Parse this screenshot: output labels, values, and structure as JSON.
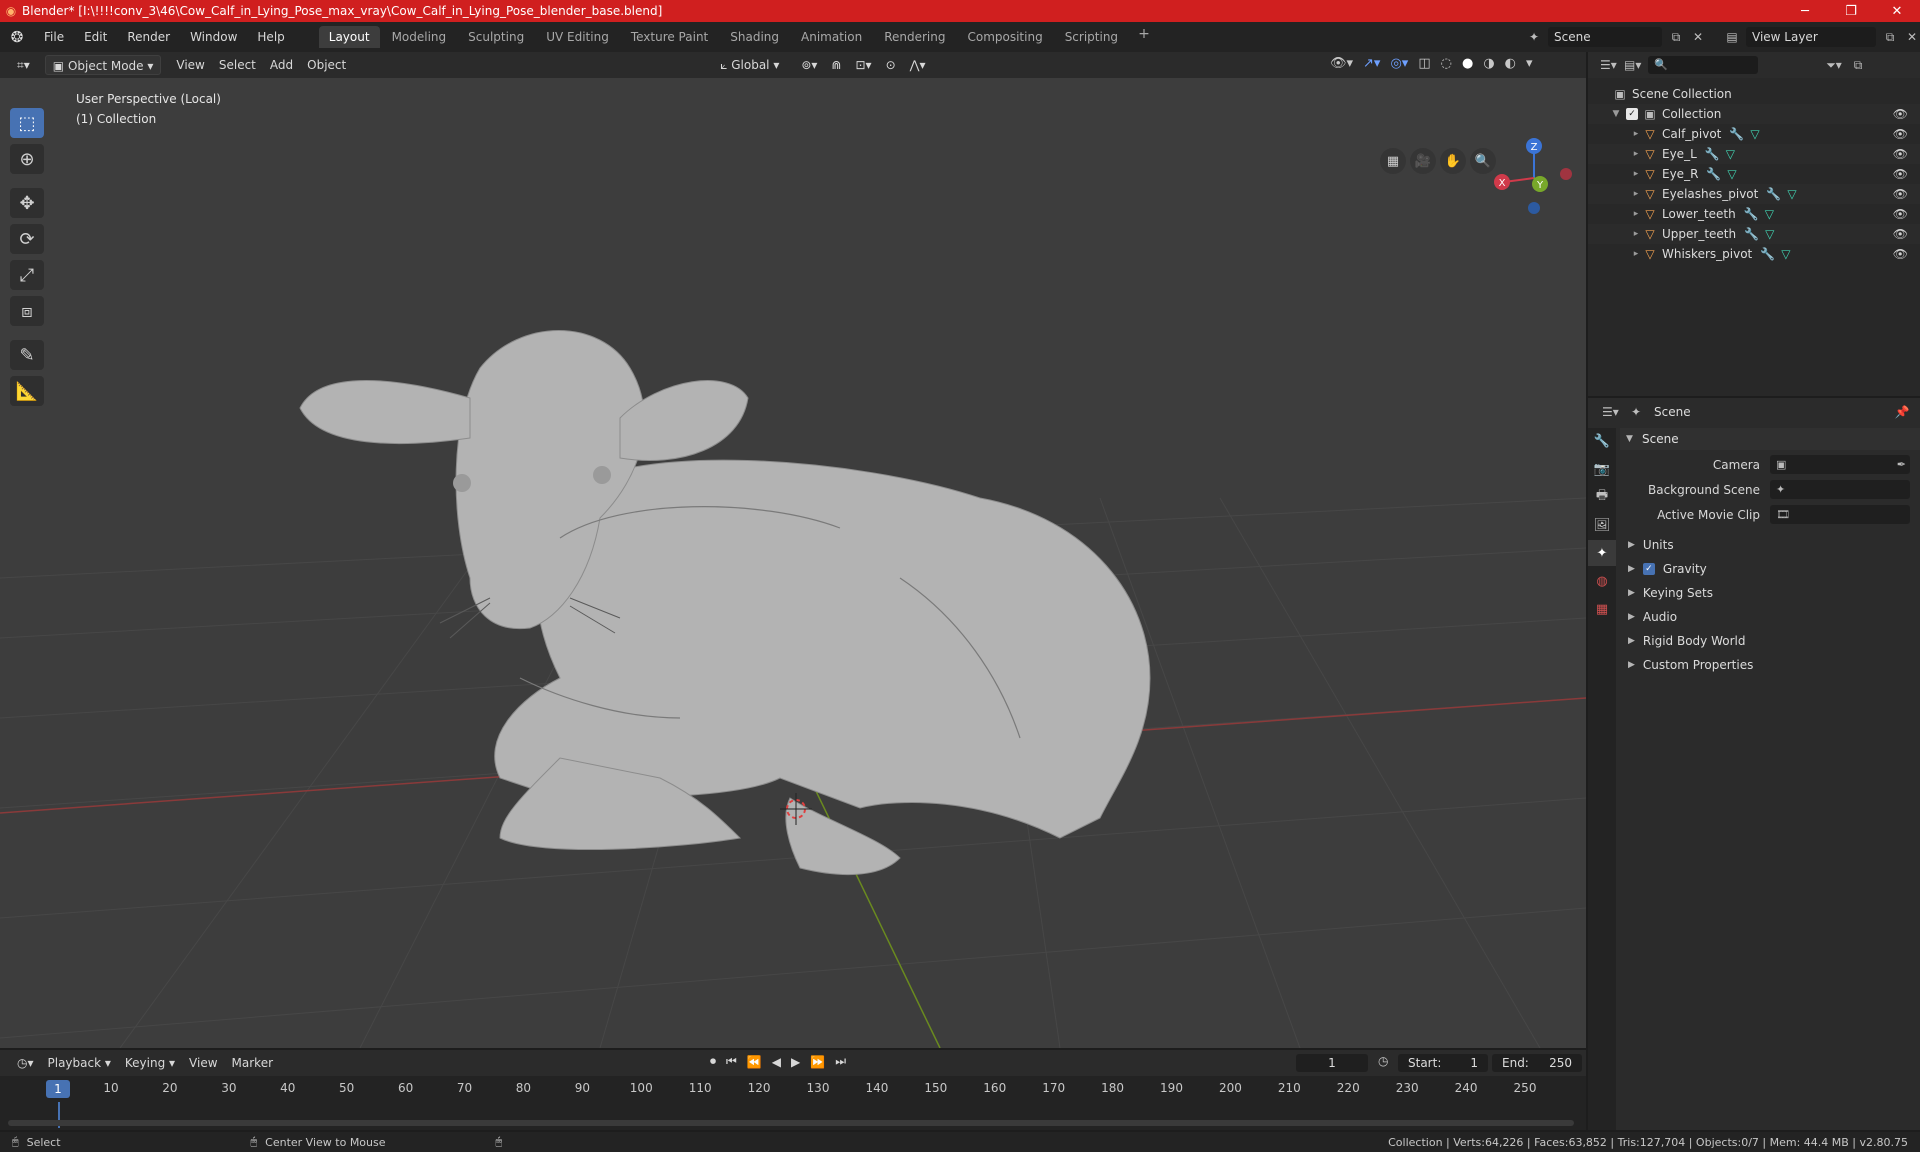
{
  "window": {
    "title": "Blender* [I:\\!!!!conv_3\\46\\Cow_Calf_in_Lying_Pose_max_vray\\Cow_Calf_in_Lying_Pose_blender_base.blend]",
    "minimize": "─",
    "maximize": "❐",
    "close": "✕"
  },
  "menu": {
    "items": [
      "File",
      "Edit",
      "Render",
      "Window",
      "Help"
    ]
  },
  "workspaces": {
    "tabs": [
      "Layout",
      "Modeling",
      "Sculpting",
      "UV Editing",
      "Texture Paint",
      "Shading",
      "Animation",
      "Rendering",
      "Compositing",
      "Scripting"
    ],
    "active": "Layout",
    "add": "+"
  },
  "scene_selector": {
    "value": "Scene"
  },
  "viewlayer_selector": {
    "value": "View Layer"
  },
  "viewport_header": {
    "mode": "Object Mode",
    "menus": [
      "View",
      "Select",
      "Add",
      "Object"
    ],
    "transform_orientation": "Global"
  },
  "viewport": {
    "perspective_label": "User Perspective (Local)",
    "collection_label": "(1) Collection",
    "gizmo": {
      "x": "X",
      "y": "Y",
      "z": "Z"
    }
  },
  "outliner": {
    "root": "Scene Collection",
    "collection": "Collection",
    "objects": [
      "Calf_pivot",
      "Eye_L",
      "Eye_R",
      "Eyelashes_pivot",
      "Lower_teeth",
      "Upper_teeth",
      "Whiskers_pivot"
    ]
  },
  "properties": {
    "header": "Scene",
    "panel_scene": "Scene",
    "fields": [
      {
        "label": "Camera"
      },
      {
        "label": "Background Scene"
      },
      {
        "label": "Active Movie Clip"
      }
    ],
    "subpanels": [
      "Units",
      "Gravity",
      "Keying Sets",
      "Audio",
      "Rigid Body World",
      "Custom Properties"
    ]
  },
  "timeline": {
    "menus": [
      "Playback",
      "Keying",
      "View",
      "Marker"
    ],
    "current_frame": "1",
    "start_label": "Start:",
    "start": "1",
    "end_label": "End:",
    "end": "250",
    "ticks": [
      "1",
      "10",
      "20",
      "30",
      "40",
      "50",
      "60",
      "70",
      "80",
      "90",
      "100",
      "110",
      "120",
      "130",
      "140",
      "150",
      "160",
      "170",
      "180",
      "190",
      "200",
      "210",
      "220",
      "230",
      "240",
      "250"
    ]
  },
  "statusbar": {
    "select": "Select",
    "center": "Center View to Mouse",
    "stats": "Collection | Verts:64,226 | Faces:63,852 | Tris:127,704 | Objects:0/7 | Mem: 44.4 MB | v2.80.75"
  },
  "colors": {
    "accent": "#4772b3",
    "titlebar": "#d01f1f",
    "object_icon": "#f0a050",
    "modifier_icon": "#6ea0ff",
    "mesh_icon": "#41d1b0"
  }
}
